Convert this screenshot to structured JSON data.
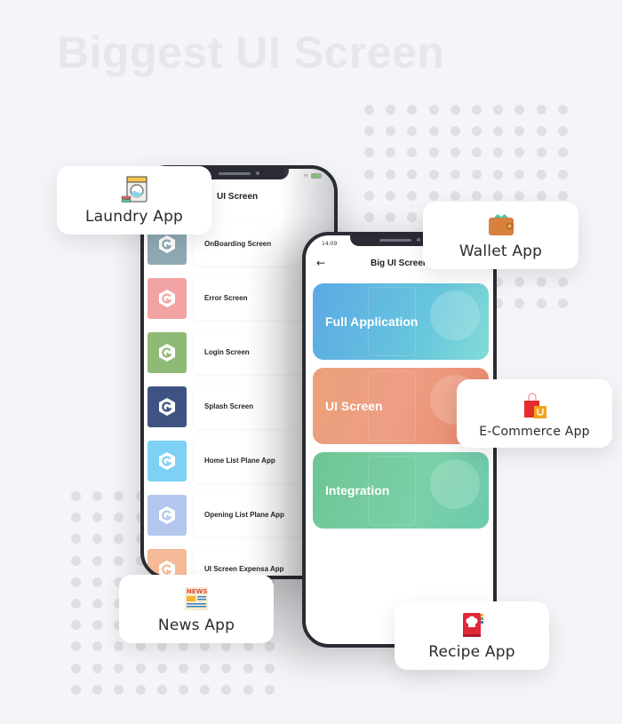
{
  "headline": "Biggest UI Screen",
  "phone_back": {
    "title": "UI Screen",
    "status": {
      "wifi_icon": "wifi-icon",
      "battery_icon": "battery-icon"
    },
    "items": [
      {
        "label": "OnBoarding Screen",
        "color": "#8fa9b3"
      },
      {
        "label": "Error Screen",
        "color": "#f2a4a4"
      },
      {
        "label": "Login Screen",
        "color": "#8fba76"
      },
      {
        "label": "Splash Screen",
        "color": "#3f5382"
      },
      {
        "label": "Home List Plane App",
        "color": "#7dd1f5"
      },
      {
        "label": "Opening List Plane App",
        "color": "#b3c6ee"
      },
      {
        "label": "UI Screen Expensa App",
        "color": "#f5bb98"
      }
    ]
  },
  "phone_front": {
    "time": "14:09",
    "title": "Big UI Screen",
    "back_icon": "arrow-left-icon",
    "cards": [
      {
        "label": "Full Application"
      },
      {
        "label": "UI Screen"
      },
      {
        "label": "Integration"
      }
    ]
  },
  "badges": {
    "laundry": {
      "label": "Laundry App",
      "icon": "washing-machine-icon"
    },
    "wallet": {
      "label": "Wallet App",
      "icon": "wallet-icon"
    },
    "ecommerce": {
      "label": "E-Commerce App",
      "icon": "shopping-bags-icon"
    },
    "news": {
      "label": "News App",
      "icon": "newspaper-icon"
    },
    "recipe": {
      "label": "Recipe App",
      "icon": "recipe-book-icon"
    }
  }
}
